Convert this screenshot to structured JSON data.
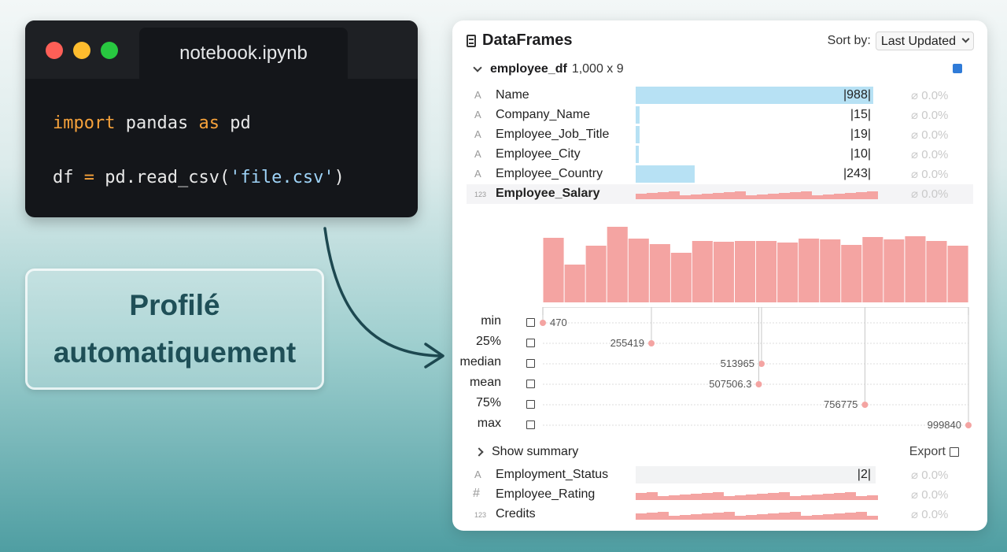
{
  "code_window": {
    "tab_title": "notebook.ipynb",
    "line1": {
      "kw1": "import",
      "mid": " pandas ",
      "kw2": "as",
      "end": " pd"
    },
    "line2": {
      "start": "df ",
      "op": "=",
      "call": " pd.read_csv(",
      "str": "'file.csv'",
      "end": ")"
    }
  },
  "callout": {
    "line1": "Profilé",
    "line2": "automatiquement"
  },
  "panel": {
    "title": "DataFrames",
    "sort_label": "Sort by:",
    "sort_value": "Last Updated",
    "dataframe": {
      "name": "employee_df",
      "shape": "1,000 x 9",
      "color": "#2f7bd8"
    },
    "columns": [
      {
        "type": "A",
        "name": "Name",
        "kind": "text",
        "count": "|988|",
        "fill": 0.99,
        "missing": "0.0%"
      },
      {
        "type": "A",
        "name": "Company_Name",
        "kind": "text",
        "count": "|15|",
        "fill": 0.015,
        "missing": "0.0%"
      },
      {
        "type": "A",
        "name": "Employee_Job_Title",
        "kind": "text",
        "count": "|19|",
        "fill": 0.015,
        "missing": "0.0%"
      },
      {
        "type": "A",
        "name": "Employee_City",
        "kind": "text",
        "count": "|10|",
        "fill": 0.012,
        "missing": "0.0%"
      },
      {
        "type": "A",
        "name": "Employee_Country",
        "kind": "text",
        "count": "|243|",
        "fill": 0.245,
        "missing": "0.0%"
      },
      {
        "type": "123",
        "name": "Employee_Salary",
        "kind": "numeric",
        "count": "",
        "fill": 0,
        "missing": "0.0%"
      }
    ],
    "more_columns": [
      {
        "type": "A",
        "name": "Employment_Status",
        "kind": "text",
        "count": "|2|",
        "fill": 0,
        "missing": "0.0%"
      },
      {
        "type": "#",
        "name": "Employee_Rating",
        "kind": "numeric",
        "count": "",
        "fill": 0,
        "missing": "0.0%"
      },
      {
        "type": "123",
        "name": "Credits",
        "kind": "numeric",
        "count": "",
        "fill": 0,
        "missing": "0.0%"
      }
    ],
    "histogram": [
      82,
      48,
      72,
      96,
      81,
      74,
      63,
      78,
      77,
      78,
      78,
      76,
      81,
      80,
      73,
      83,
      80,
      84,
      78,
      72
    ],
    "stats": [
      {
        "label": "min",
        "value": "470",
        "num": 470
      },
      {
        "label": "25%",
        "value": "255419",
        "num": 255419
      },
      {
        "label": "median",
        "value": "513965",
        "num": 513965
      },
      {
        "label": "mean",
        "value": "507506.3",
        "num": 507506.3
      },
      {
        "label": "75%",
        "value": "756775",
        "num": 756775
      },
      {
        "label": "max",
        "value": "999840",
        "num": 999840
      }
    ],
    "show_summary": "Show summary",
    "export": "Export"
  },
  "colors": {
    "salmon": "#f4a4a2",
    "blue_bar": "#b7e1f4",
    "track": "#f2f3f4"
  }
}
